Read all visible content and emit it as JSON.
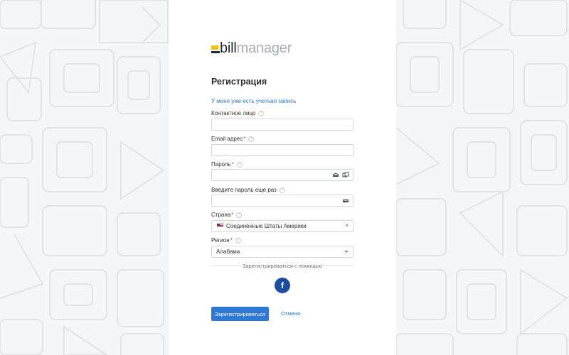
{
  "logo": {
    "part1": "bill",
    "part2": "manager"
  },
  "form": {
    "title": "Регистрация",
    "login_link": "У меня уже есть учетная запись",
    "fields": {
      "contact": {
        "label": "Контактное лицо",
        "value": ""
      },
      "email": {
        "label": "Email адрес",
        "required_mark": "*",
        "value": ""
      },
      "password": {
        "label": "Пароль",
        "required_mark": "*",
        "value": ""
      },
      "password_repeat": {
        "label": "Введите пароль еще раз",
        "value": ""
      },
      "country": {
        "label": "Страна",
        "required_mark": "*",
        "value": "Соединенные Штаты Америки",
        "clear": "×"
      },
      "region": {
        "label": "Регион",
        "required_mark": "*",
        "value": "Алабама"
      }
    },
    "help_glyph": "?",
    "social_label": "Зарегистрироваться с помощью",
    "facebook_glyph": "f",
    "submit_label": "Зарегистрироваться",
    "cancel_label": "Отмена"
  },
  "colors": {
    "accent": "#2f78d6",
    "link": "#2a76c6",
    "required": "#e2413a",
    "facebook": "#1d4e9e",
    "logo_yellow": "#f2c200"
  },
  "icons": [
    "eye-icon",
    "password-generate-icon",
    "us-flag-icon",
    "chevron-down-icon",
    "facebook-icon"
  ]
}
